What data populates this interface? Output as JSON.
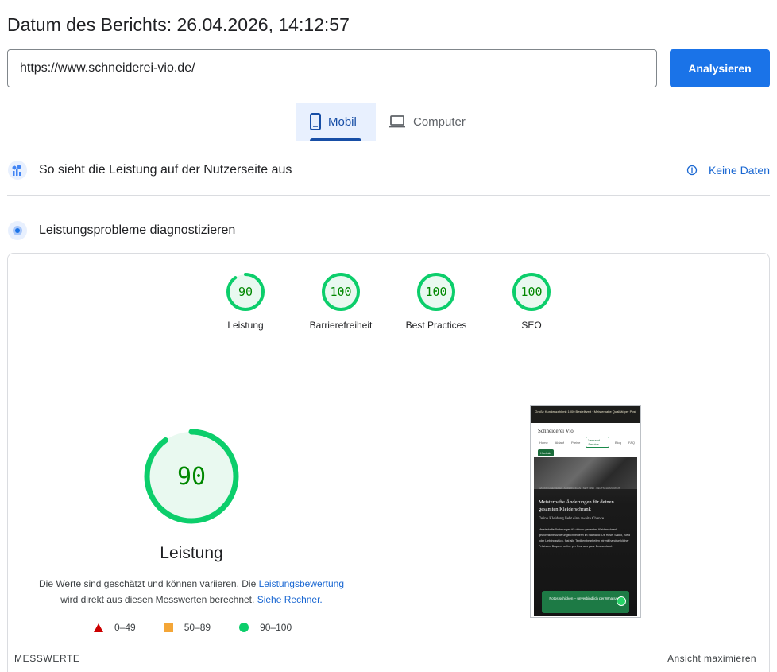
{
  "header": {
    "report_date": "Datum des Berichts: 26.04.2026, 14:12:57"
  },
  "search": {
    "url_value": "https://www.schneiderei-vio.de/",
    "analyze_label": "Analysieren"
  },
  "tabs": [
    {
      "label": "Mobil",
      "active": true,
      "icon": "smartphone-icon"
    },
    {
      "label": "Computer",
      "active": false,
      "icon": "laptop-icon"
    }
  ],
  "field_section": {
    "title": "So sieht die Leistung auf der Nutzerseite aus",
    "no_data_label": "Keine Daten"
  },
  "lab_section": {
    "title": "Leistungsprobleme diagnostizieren"
  },
  "scores": [
    {
      "label": "Leistung",
      "value": "90",
      "fraction": 0.9,
      "color": "#0cce6b"
    },
    {
      "label": "Barrierefreiheit",
      "value": "100",
      "fraction": 1.0,
      "color": "#0cce6b"
    },
    {
      "label": "Best Practices",
      "value": "100",
      "fraction": 1.0,
      "color": "#0cce6b"
    },
    {
      "label": "SEO",
      "value": "100",
      "fraction": 1.0,
      "color": "#0cce6b"
    }
  ],
  "performance": {
    "score": "90",
    "fraction": 0.9,
    "label": "Leistung",
    "note_part1": "Die Werte sind geschätzt und können variieren. Die ",
    "note_link1": "Leistungsbewertung",
    "note_part2": " wird direkt aus diesen Messwerten berechnet.",
    "note_link2": "Siehe Rechner."
  },
  "legend": [
    {
      "range": "0–49",
      "color": "#cc0000",
      "shape": "triangle"
    },
    {
      "range": "50–89",
      "color": "#f4a637",
      "shape": "square"
    },
    {
      "range": "90–100",
      "color": "#0cce6b",
      "shape": "circle"
    }
  ],
  "footer": {
    "metrics_label": "MESSWERTE",
    "expand_label": "Ansicht maximieren"
  },
  "screenshot": {
    "topbar": "Große Kundenzahl mit 1000 Bestellwert · Meisterhafte Qualität per Post",
    "brand": "Schneiderei Vio",
    "nav": [
      "Home",
      "Ablauf",
      "Preise",
      "Versand-Service",
      "Blog",
      "FAQ"
    ],
    "kontakt": "Kontakt",
    "kicker": "MASSSCHNEIDEREI · ÄNDERUNGEN · SEIT 1999 · DEUTSCHLANDWEIT",
    "headline": "Meisterhafte Änderungen für deinen gesamten Kleiderschrank",
    "subline": "Deine Kleidung liebt eine zweite Chance",
    "body": "Meisterhafte Änderungen für deinen gesamten Kleiderschrank – gewöhnliche Änderungsschneiderei im Saarland: Ob Hose, Sakko, Kleid oder Lieblingsstück, fast alle Textilien bearbeiten wir mit handwerklicher Präzision. Bequem online per Post aus ganz Deutschland.",
    "cta": "Fotos schicken – unverbindlich per WhatsApp"
  }
}
